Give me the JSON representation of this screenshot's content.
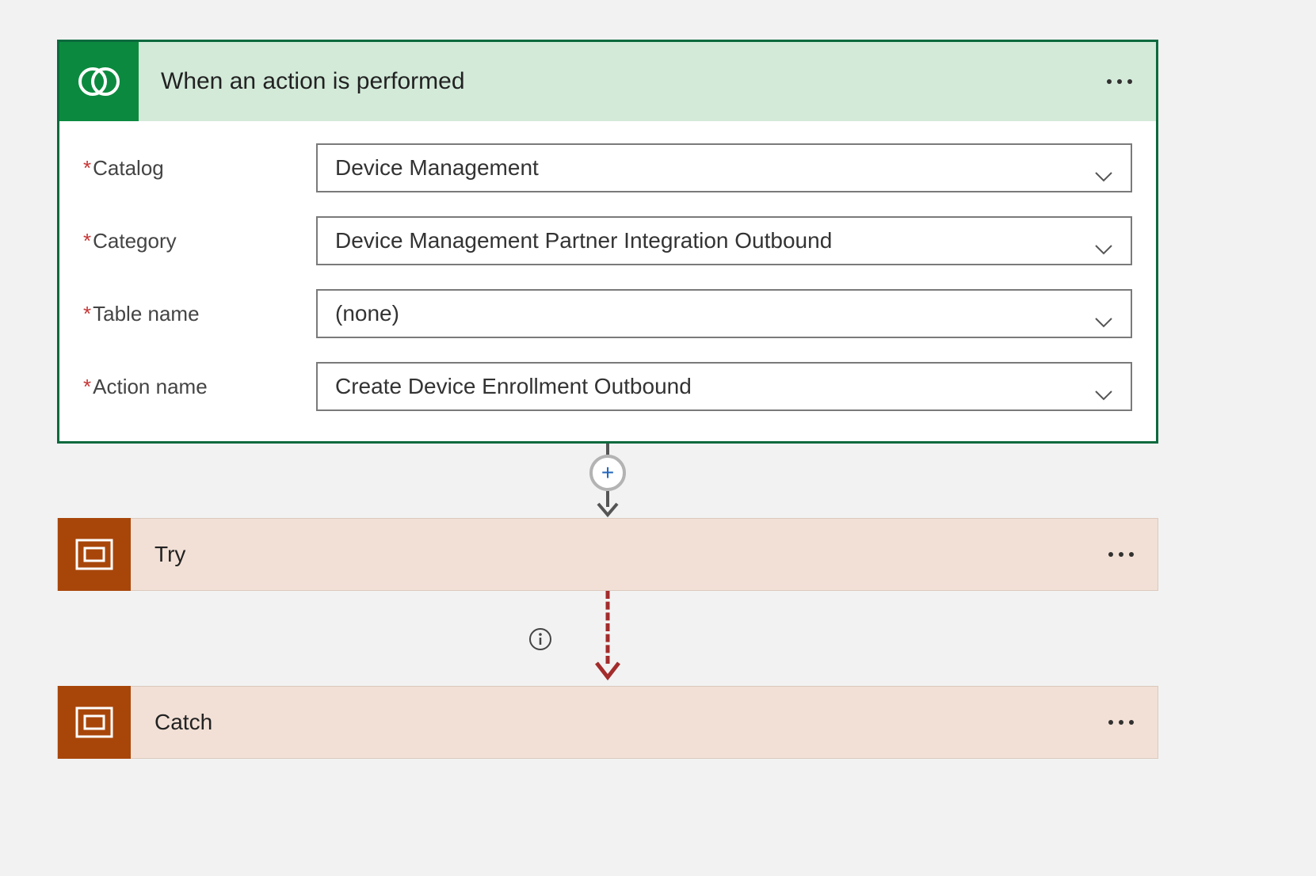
{
  "trigger": {
    "title": "When an action is performed",
    "fields": {
      "catalog": {
        "label": "Catalog",
        "value": "Device Management"
      },
      "category": {
        "label": "Category",
        "value": "Device Management Partner Integration Outbound"
      },
      "table_name": {
        "label": "Table name",
        "value": "(none)"
      },
      "action_name": {
        "label": "Action name",
        "value": "Create Device Enrollment Outbound"
      }
    }
  },
  "scopes": {
    "try": {
      "title": "Try"
    },
    "catch": {
      "title": "Catch"
    }
  },
  "icons": {
    "trigger": "dataverse-swirl-icon",
    "scope": "scope-container-icon",
    "more": "more-ellipsis",
    "plus": "+",
    "info": "info-icon"
  },
  "colors": {
    "trigger_accent": "#0b8a3f",
    "trigger_header_bg": "#d3ead9",
    "trigger_border": "#0b6a3d",
    "scope_accent": "#a8460a",
    "scope_bg": "#f2e0d6",
    "error_connector": "#a32c2c"
  }
}
